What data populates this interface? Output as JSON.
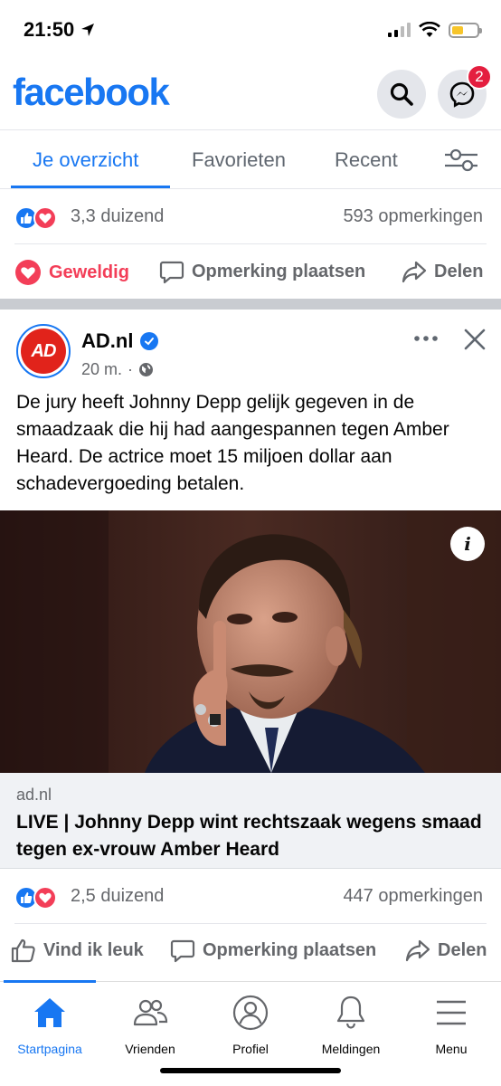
{
  "status": {
    "time": "21:50"
  },
  "header": {
    "logo": "facebook",
    "messenger_badge": "2"
  },
  "tabs": [
    {
      "label": "Je overzicht",
      "active": true
    },
    {
      "label": "Favorieten"
    },
    {
      "label": "Recent"
    }
  ],
  "prev_post": {
    "reaction_count": "3,3 duizend",
    "comment_count": "593 opmerkingen",
    "actions": {
      "love": "Geweldig",
      "comment": "Opmerking plaatsen",
      "share": "Delen"
    }
  },
  "post": {
    "page_name": "AD.nl",
    "avatar_text": "AD",
    "time": "20 m.",
    "dot": "·",
    "text": "De jury heeft Johnny Depp gelijk gegeven in de smaadzaak die hij had aangespannen tegen Amber Heard. De actrice moet 15 miljoen dollar aan schadevergoeding betalen.",
    "info_glyph": "i",
    "link": {
      "domain": "ad.nl",
      "title": "LIVE | Johnny Depp wint rechtszaak wegens smaad tegen ex-vrouw Amber Heard"
    },
    "reaction_count": "2,5 duizend",
    "comment_count": "447 opmerkingen",
    "actions": {
      "like": "Vind ik leuk",
      "comment": "Opmerking plaatsen",
      "share": "Delen"
    }
  },
  "bottom_nav": [
    {
      "label": "Startpagina",
      "icon": "home-icon",
      "active": true
    },
    {
      "label": "Vrienden",
      "icon": "friends-icon"
    },
    {
      "label": "Profiel",
      "icon": "profile-icon"
    },
    {
      "label": "Meldingen",
      "icon": "bell-icon"
    },
    {
      "label": "Menu",
      "icon": "menu-icon"
    }
  ],
  "colors": {
    "brand": "#1877f2",
    "love": "#f33e58",
    "badge": "#e41e3f",
    "ad_red": "#e1231b"
  }
}
